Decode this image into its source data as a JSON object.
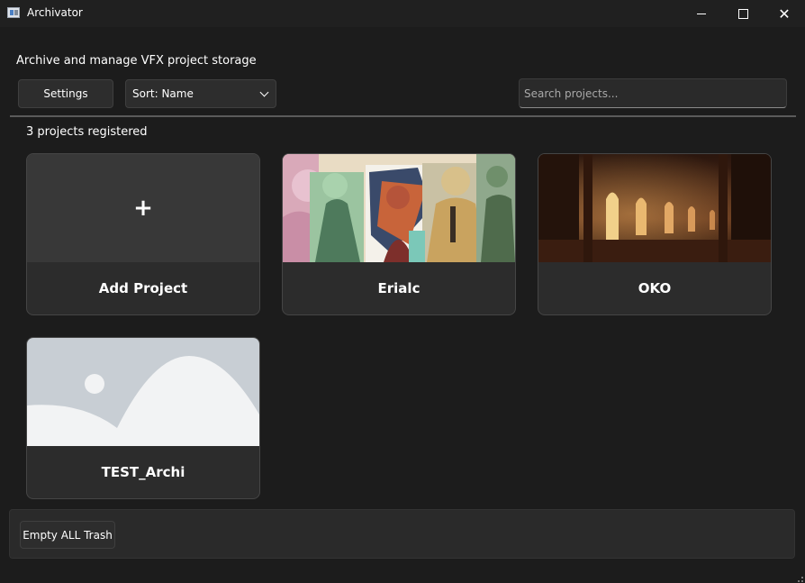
{
  "window": {
    "title": "Archivator"
  },
  "header": {
    "subtitle": "Archive and manage VFX project storage"
  },
  "toolbar": {
    "settings_label": "Settings",
    "sort_value": "Sort: Name",
    "search_placeholder": "Search projects..."
  },
  "projects": {
    "count_text": "3 projects registered",
    "add_label": "Add Project",
    "add_symbol": "+",
    "items": [
      {
        "name": "Erialc",
        "thumbnail": "illustrated-characters-artwork"
      },
      {
        "name": "OKO",
        "thumbnail": "gothic-library-hall-render"
      },
      {
        "name": "TEST_Archi",
        "thumbnail": "image-placeholder-icon"
      }
    ]
  },
  "footer": {
    "empty_trash_label": "Empty ALL Trash"
  },
  "colors": {
    "background": "#1c1c1c",
    "card": "#2c2c2c",
    "card_border": "#454545",
    "text": "#ffffff",
    "placeholder_image": "#c8ced4"
  }
}
